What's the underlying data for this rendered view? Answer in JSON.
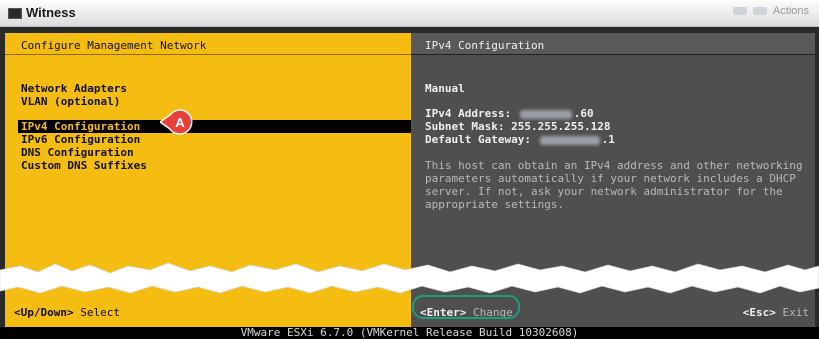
{
  "window": {
    "title": "Witness",
    "actions_label": "Actions"
  },
  "left_pane": {
    "header": "Configure Management Network",
    "menu": [
      {
        "label": "Network Adapters",
        "selected": false
      },
      {
        "label": "VLAN (optional)",
        "selected": false
      },
      {
        "label": "IPv4 Configuration",
        "selected": true
      },
      {
        "label": "IPv6 Configuration",
        "selected": false
      },
      {
        "label": "DNS Configuration",
        "selected": false
      },
      {
        "label": "Custom DNS Suffixes",
        "selected": false
      }
    ],
    "footer": {
      "key": "<Up/Down>",
      "action": "Select"
    }
  },
  "right_pane": {
    "header": "IPv4 Configuration",
    "mode": "Manual",
    "ipv4_address": {
      "label": "IPv4 Address:",
      "visible_suffix": ".60"
    },
    "subnet_mask": {
      "label": "Subnet Mask:",
      "value": "255.255.255.128"
    },
    "default_gateway": {
      "label": "Default Gateway:",
      "visible_suffix": ".1"
    },
    "description": [
      "This host can obtain an IPv4 address and other networking",
      "parameters automatically if your network includes a DHCP",
      "server. If not, ask your network administrator for the",
      "appropriate settings."
    ],
    "footer_change": {
      "key": "<Enter>",
      "action": "Change"
    },
    "footer_exit": {
      "key": "<Esc>",
      "action": "Exit"
    }
  },
  "status_bar": "VMware ESXi 6.7.0 (VMKernel Release Build 10302608)",
  "annotation": {
    "callout_label": "A",
    "callout_color": "#e8413c",
    "ring_color": "#1c9d7c"
  },
  "colors": {
    "yellow": "#f5bd12",
    "gray": "#4f4f4f"
  }
}
